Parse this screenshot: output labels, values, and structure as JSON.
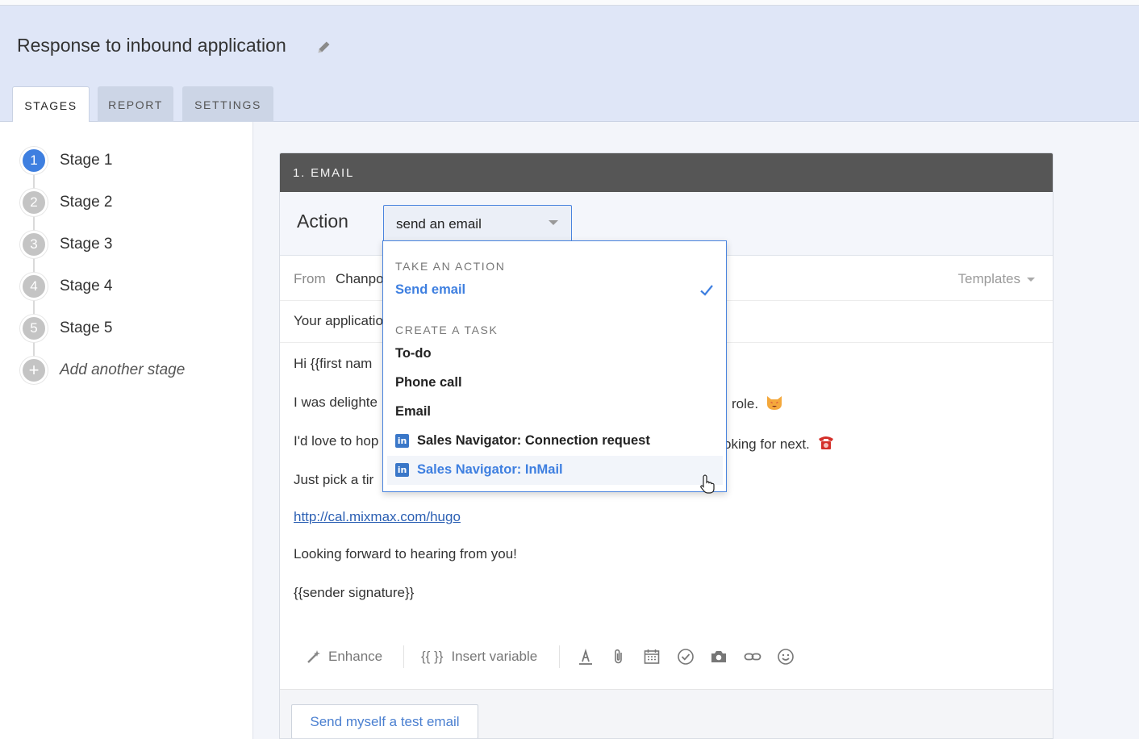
{
  "header": {
    "title": "Response to inbound application",
    "tabs": [
      {
        "label": "STAGES"
      },
      {
        "label": "REPORT"
      },
      {
        "label": "SETTINGS"
      }
    ]
  },
  "sidebar": {
    "stages": [
      {
        "num": "1",
        "label": "Stage 1"
      },
      {
        "num": "2",
        "label": "Stage 2"
      },
      {
        "num": "3",
        "label": "Stage 3"
      },
      {
        "num": "4",
        "label": "Stage 4"
      },
      {
        "num": "5",
        "label": "Stage 5"
      }
    ],
    "add_icon": "+",
    "add_label": "Add another stage"
  },
  "card": {
    "header": "1. EMAIL",
    "action_label": "Action",
    "select_value": "send an email",
    "from_label": "From",
    "from_value": "Chanpo",
    "templates_label": "Templates",
    "subject": "Your applicatio",
    "body": {
      "line1": "Hi {{first nam",
      "line2_start": "I was delighte",
      "line2_end": "role.",
      "line3_start": "I'd love to hop",
      "line3_end": "oking for next.",
      "line4": "Just pick a tir",
      "link": "http://cal.mixmax.com/hugo",
      "line6": "Looking forward to hearing from you!",
      "line7": "{{sender signature}}"
    },
    "toolbar": {
      "enhance": "Enhance",
      "insert_variable_glyph": "{{ }}",
      "insert_variable": "Insert variable",
      "icons": [
        "font-color-icon",
        "attachment-icon",
        "calendar-icon",
        "checkmark-icon",
        "camera-icon",
        "link-icon",
        "emoji-icon"
      ]
    },
    "test_button": "Send myself a test email"
  },
  "dropdown": {
    "section1": "TAKE AN ACTION",
    "send_email": "Send email",
    "section2": "CREATE A TASK",
    "todo": "To-do",
    "phone_call": "Phone call",
    "email": "Email",
    "linkedin_glyph": "in",
    "sn_connection": "Sales Navigator: Connection request",
    "sn_inmail": "Sales Navigator: InMail"
  },
  "colors": {
    "accent": "#3e7fe0",
    "header_bg": "#dfe6f7",
    "card_header": "#565656",
    "link": "#2b5fb3",
    "linkedin": "#3a77c8"
  }
}
